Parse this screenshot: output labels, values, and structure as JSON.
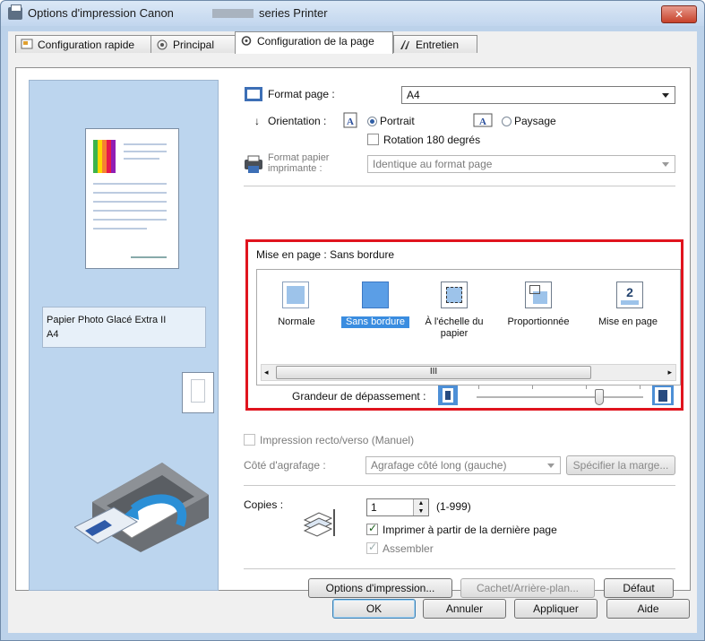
{
  "window": {
    "title_part1": "Options d'impression Canon",
    "title_part2": "series Printer",
    "close_label": "✕"
  },
  "tabs": [
    {
      "label": "Configuration rapide"
    },
    {
      "label": "Principal"
    },
    {
      "label": "Configuration de la page"
    },
    {
      "label": "Entretien"
    }
  ],
  "preview": {
    "paper_label_line1": "Papier Photo Glacé Extra II",
    "paper_label_line2": "A4"
  },
  "page_setup": {
    "format_page_label": "Format page :",
    "format_page_value": "A4",
    "orientation_label": "Orientation :",
    "portrait_label": "Portrait",
    "paysage_label": "Paysage",
    "orientation_selected": "Portrait",
    "rotation_label": "Rotation 180 degrés",
    "rotation_checked": false,
    "format_papier_label_line1": "Format papier",
    "format_papier_label_line2": "imprimante :",
    "format_papier_value": "Identique au format page"
  },
  "layout": {
    "label": "Mise en page :",
    "value": "Sans bordure",
    "items": [
      {
        "label": "Normale"
      },
      {
        "label": "Sans bordure",
        "selected": true
      },
      {
        "label": "À l'échelle du papier"
      },
      {
        "label": "Proportionnée"
      },
      {
        "label": "Mise en page"
      }
    ],
    "scroll_grip": "III",
    "overflow_label": "Grandeur de dépassement :",
    "overflow_level": 0.75
  },
  "duplex": {
    "recto_verso_label": "Impression recto/verso (Manuel)",
    "recto_verso_checked": false,
    "agrafage_label": "Côté d'agrafage :",
    "agrafage_value": "Agrafage côté long (gauche)",
    "margin_button": "Spécifier la marge..."
  },
  "copies": {
    "label": "Copies :",
    "value": "1",
    "range": "(1-999)",
    "reverse_label": "Imprimer à partir de la dernière page",
    "reverse_checked": true,
    "collate_label": "Assembler",
    "collate_checked": true
  },
  "bottom_buttons": {
    "options": "Options d'impression...",
    "stamp": "Cachet/Arrière-plan...",
    "default": "Défaut"
  },
  "dialog_buttons": {
    "ok": "OK",
    "cancel": "Annuler",
    "apply": "Appliquer",
    "help": "Aide"
  }
}
